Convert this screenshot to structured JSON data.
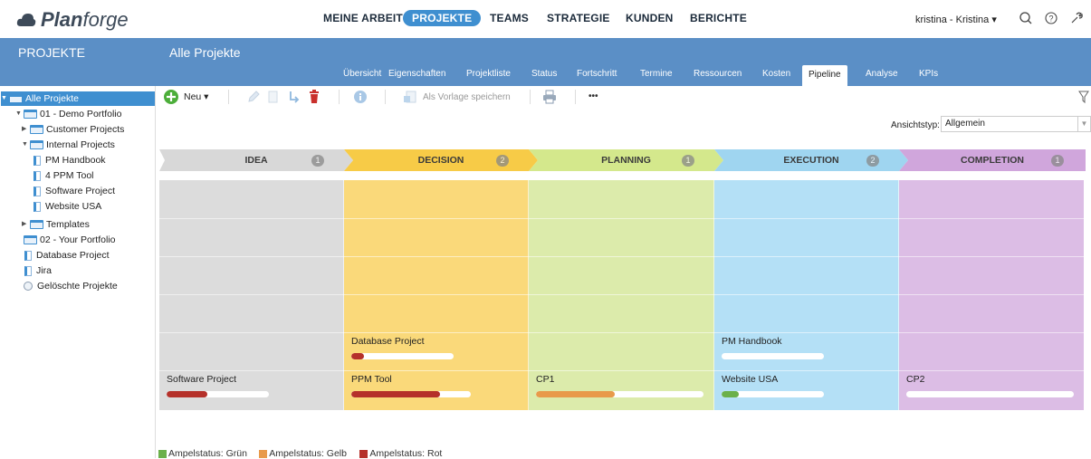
{
  "app": {
    "brand_bold": "Plan",
    "brand_rest": "forge"
  },
  "nav": [
    {
      "label": "MEINE ARBEIT"
    },
    {
      "label": "PROJEKTE"
    },
    {
      "label": "TEAMS"
    },
    {
      "label": "STRATEGIE"
    },
    {
      "label": "KUNDEN"
    },
    {
      "label": "BERICHTE"
    }
  ],
  "user": {
    "label": "kristina - Kristina ▾"
  },
  "icons": {
    "search": "search-icon",
    "help": "help-icon",
    "settings": "wrench-icon"
  },
  "left_header": {
    "title": "PROJEKTE"
  },
  "main_header": {
    "title": "Alle Projekte"
  },
  "tabs": [
    {
      "label": "Übersicht"
    },
    {
      "label": "Eigenschaften"
    },
    {
      "label": "Projektliste"
    },
    {
      "label": "Status"
    },
    {
      "label": "Fortschritt"
    },
    {
      "label": "Termine"
    },
    {
      "label": "Ressourcen"
    },
    {
      "label": "Kosten"
    },
    {
      "label": "Pipeline"
    },
    {
      "label": "Analyse"
    },
    {
      "label": "KPIs"
    }
  ],
  "tree": [
    {
      "label": "Alle Projekte"
    },
    {
      "label": "01 - Demo Portfolio"
    },
    {
      "label": "Customer Projects"
    },
    {
      "label": "Internal Projects"
    },
    {
      "label": "PM Handbook"
    },
    {
      "label": "4 PPM Tool"
    },
    {
      "label": "Software Project"
    },
    {
      "label": "Website USA"
    },
    {
      "label": "Templates"
    },
    {
      "label": "02 - Your Portfolio"
    },
    {
      "label": "Database Project"
    },
    {
      "label": "Jira"
    },
    {
      "label": "Gelöschte Projekte"
    }
  ],
  "toolbar": {
    "new_label": "Neu ▾",
    "template_label": "Als Vorlage speichern",
    "more_label": "•••"
  },
  "view_type": {
    "label": "Ansichtstyp:",
    "value": "Allgemein"
  },
  "phases": [
    {
      "label": "IDEA",
      "count": "1",
      "color": "#d8d8d8",
      "cell": "#dcdcdc"
    },
    {
      "label": "DECISION",
      "count": "2",
      "color": "#f7cb47",
      "cell": "#fad97a"
    },
    {
      "label": "PLANNING",
      "count": "1",
      "color": "#d4e88c",
      "cell": "#dcebab"
    },
    {
      "label": "EXECUTION",
      "count": "2",
      "color": "#9fd5f0",
      "cell": "#b4e0f6"
    },
    {
      "label": "COMPLETION",
      "count": "1",
      "color": "#d0a6dc",
      "cell": "#dcbde5"
    }
  ],
  "projects": [
    {
      "name": "Database Project",
      "phase": 1,
      "row": 0,
      "progress": 0.12,
      "status_color": "#b5312a"
    },
    {
      "name": "PM Handbook",
      "phase": 3,
      "row": 0,
      "progress": 0.0,
      "status_color": "#6bb04a"
    },
    {
      "name": "Software Project",
      "phase": 0,
      "row": 1,
      "progress": 0.4,
      "status_color": "#b5312a"
    },
    {
      "name": "PPM Tool",
      "phase": 1,
      "row": 1,
      "progress": 0.74,
      "status_color": "#b5312a"
    },
    {
      "name": "CP1",
      "phase": 2,
      "row": 1,
      "progress": 0.47,
      "status_color": "#e89a4a"
    },
    {
      "name": "Website USA",
      "phase": 3,
      "row": 1,
      "progress": 0.17,
      "status_color": "#6bb04a"
    },
    {
      "name": "CP2",
      "phase": 4,
      "row": 1,
      "progress": 0.0,
      "status_color": "#6bb04a"
    }
  ],
  "legend": [
    {
      "label": "Ampelstatus: Grün",
      "color": "#6bb04a"
    },
    {
      "label": "Ampelstatus: Gelb",
      "color": "#e89a4a"
    },
    {
      "label": "Ampelstatus: Rot",
      "color": "#b5312a"
    }
  ]
}
